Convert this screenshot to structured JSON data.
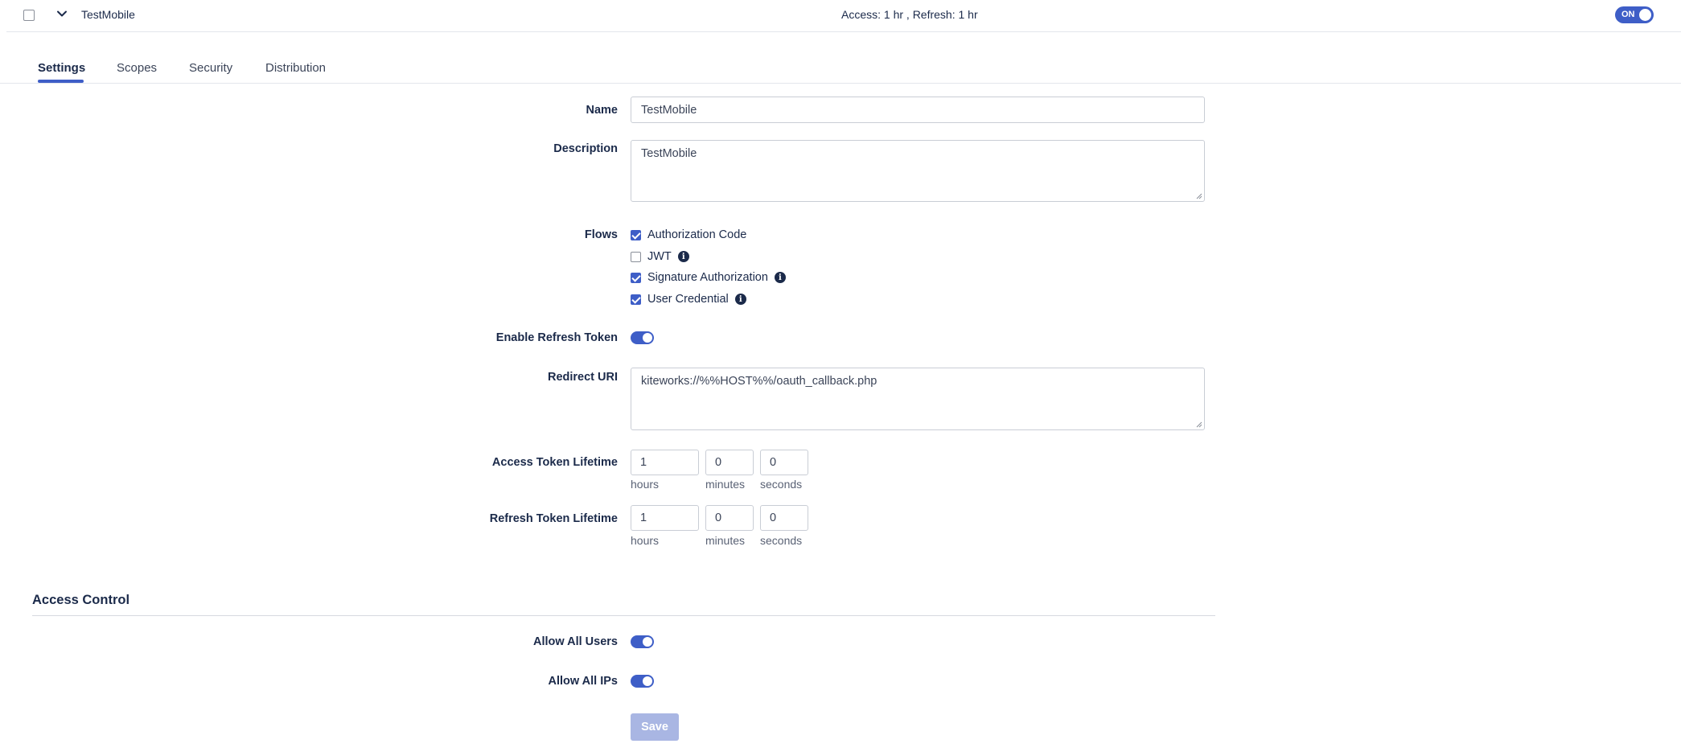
{
  "header": {
    "title": "TestMobile",
    "token_summary": "Access: 1 hr , Refresh: 1 hr",
    "status_toggle_label": "ON"
  },
  "tabs": [
    {
      "label": "Settings",
      "active": true
    },
    {
      "label": "Scopes",
      "active": false
    },
    {
      "label": "Security",
      "active": false
    },
    {
      "label": "Distribution",
      "active": false
    }
  ],
  "form": {
    "name_label": "Name",
    "name_value": "TestMobile",
    "description_label": "Description",
    "description_value": "TestMobile",
    "flows_label": "Flows",
    "flows": [
      {
        "label": "Authorization Code",
        "checked": true,
        "info": false
      },
      {
        "label": "JWT",
        "checked": false,
        "info": true
      },
      {
        "label": "Signature Authorization",
        "checked": true,
        "info": true
      },
      {
        "label": "User Credential",
        "checked": true,
        "info": true
      }
    ],
    "refresh_token_label": "Enable Refresh Token",
    "refresh_token_enabled": true,
    "redirect_uri_label": "Redirect URI",
    "redirect_uri_value": "kiteworks://%%HOST%%/oauth_callback.php",
    "access_lifetime_label": "Access Token Lifetime",
    "access_lifetime": {
      "hours": "1",
      "minutes": "0",
      "seconds": "0"
    },
    "refresh_lifetime_label": "Refresh Token Lifetime",
    "refresh_lifetime": {
      "hours": "1",
      "minutes": "0",
      "seconds": "0"
    },
    "units": {
      "hours": "hours",
      "minutes": "minutes",
      "seconds": "seconds"
    }
  },
  "access_control": {
    "title": "Access Control",
    "allow_all_users_label": "Allow All Users",
    "allow_all_users": true,
    "allow_all_ips_label": "Allow All IPs",
    "allow_all_ips": true
  },
  "save_label": "Save",
  "colors": {
    "accent": "#3e5ec7",
    "disabled_button": "#a9b6e3",
    "text": "#1b2a4a"
  }
}
